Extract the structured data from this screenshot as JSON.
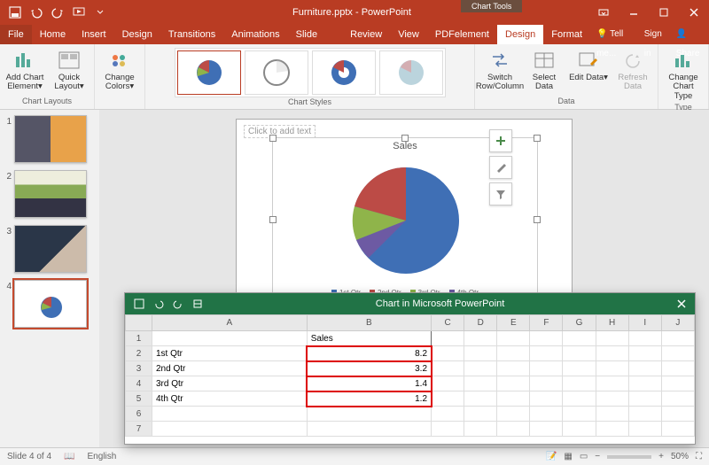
{
  "app": {
    "filename": "Furniture.pptx",
    "appname": "PowerPoint",
    "context_tab": "Chart Tools"
  },
  "tabs": {
    "file": "File",
    "list": [
      "Home",
      "Insert",
      "Design",
      "Transitions",
      "Animations",
      "Slide Show",
      "Review",
      "View",
      "PDFelement"
    ],
    "chart_tools": [
      "Design",
      "Format"
    ],
    "tellme": "Tell me...",
    "signin": "Sign in",
    "share": "Share"
  },
  "ribbon": {
    "add_chart_element": "Add Chart Element▾",
    "quick_layout": "Quick Layout▾",
    "change_colors": "Change Colors▾",
    "switch_row": "Switch Row/Column",
    "select_data": "Select Data",
    "edit_data": "Edit Data▾",
    "refresh_data": "Refresh Data",
    "change_chart_type": "Change Chart Type",
    "grp_layouts": "Chart Layouts",
    "grp_styles": "Chart Styles",
    "grp_data": "Data",
    "grp_type": "Type"
  },
  "slide": {
    "placeholder": "Click to add text",
    "chart_title": "Sales"
  },
  "thumbs": {
    "count": 4,
    "selected": 4
  },
  "excel": {
    "title": "Chart in Microsoft PowerPoint",
    "cols": [
      "A",
      "B",
      "C",
      "D",
      "E",
      "F",
      "G",
      "H",
      "I",
      "J"
    ],
    "header_b": "Sales",
    "rows": [
      {
        "n": "1",
        "a": "",
        "b": ""
      },
      {
        "n": "2",
        "a": "1st Qtr",
        "b": "8.2"
      },
      {
        "n": "3",
        "a": "2nd Qtr",
        "b": "3.2"
      },
      {
        "n": "4",
        "a": "3rd Qtr",
        "b": "1.4"
      },
      {
        "n": "5",
        "a": "4th Qtr",
        "b": "1.2"
      },
      {
        "n": "6",
        "a": "",
        "b": ""
      },
      {
        "n": "7",
        "a": "",
        "b": ""
      }
    ]
  },
  "chart_data": {
    "type": "pie",
    "title": "Sales",
    "categories": [
      "1st Qtr",
      "2nd Qtr",
      "3rd Qtr",
      "4th Qtr"
    ],
    "values": [
      8.2,
      3.2,
      1.4,
      1.2
    ],
    "colors": [
      "#3f6fb5",
      "#bc4b46",
      "#8fb44a",
      "#6d5aa3"
    ],
    "legend_position": "bottom"
  },
  "status": {
    "slide_indicator": "Slide 4 of 4",
    "language": "English",
    "zoom": "50%"
  }
}
